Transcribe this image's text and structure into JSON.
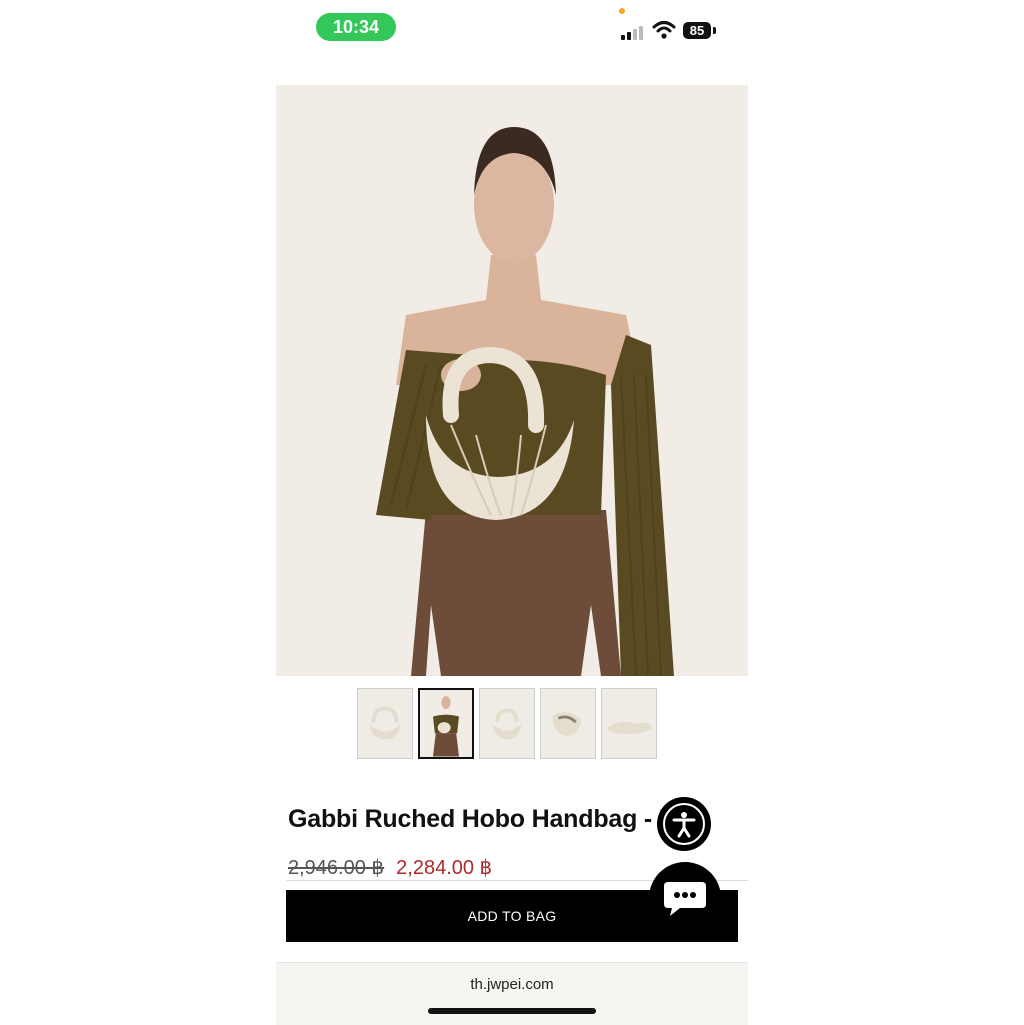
{
  "status_bar": {
    "time": "10:34",
    "battery": "85",
    "colors": {
      "time_pill": "#34c759",
      "dot": "#f5a623"
    },
    "icons": [
      "signal-icon",
      "wifi-icon",
      "battery-icon"
    ]
  },
  "product": {
    "title": "Gabbi Ruched Hobo Handbag - I",
    "price_original": "2,946.00 ฿",
    "price_sale": "2,284.00 ฿",
    "add_to_bag": "ADD TO BAG",
    "main_image": "model-holding-ivory-hobo-handbag",
    "thumbnails": [
      {
        "image": "bag-front"
      },
      {
        "image": "model-holding-bag",
        "selected": true
      },
      {
        "image": "bag-side"
      },
      {
        "image": "bag-angled"
      },
      {
        "image": "bag-lying-flat"
      }
    ]
  },
  "widgets": {
    "accessibility": "accessibility-icon",
    "chat": "chat-bubble-icon"
  },
  "browser": {
    "url": "th.jwpei.com"
  },
  "colors": {
    "sale_price": "#b0282c",
    "button": "#000000",
    "image_bg": "#f1ece5"
  }
}
